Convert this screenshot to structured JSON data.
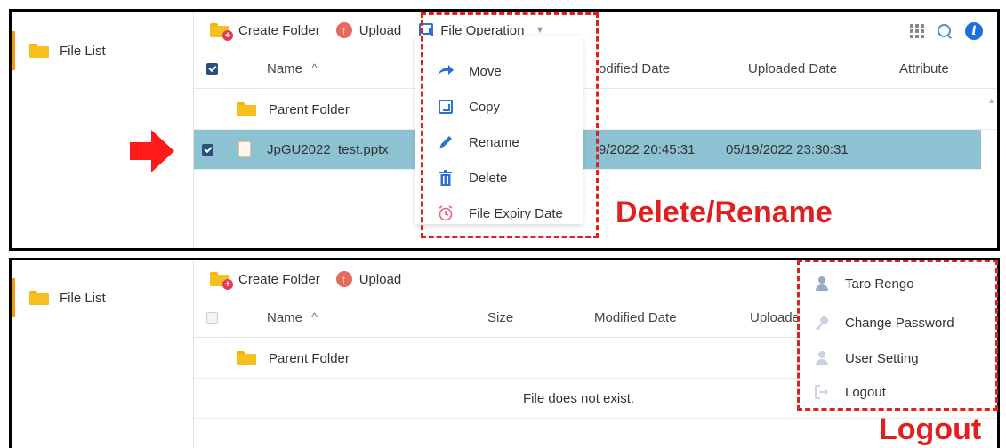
{
  "sidebar": {
    "file_list_label": "File List"
  },
  "toolbar": {
    "create_folder": "Create Folder",
    "upload": "Upload",
    "file_operation": "File Operation"
  },
  "columns": {
    "name": "Name",
    "sort_indicator": "^",
    "size": "Size",
    "modified_date": "Modified Date",
    "modified_date_partial": "odified Date",
    "uploaded_date": "Uploaded Date",
    "uploaded_date_partial": "Uploade",
    "attribute": "Attribute"
  },
  "rows_top": [
    {
      "name": "Parent Folder"
    },
    {
      "name": "JpGU2022_test.pptx",
      "modified_partial": "9/2022 20:45:31",
      "uploaded": "05/19/2022 23:30:31"
    }
  ],
  "file_operation_menu": [
    "Move",
    "Copy",
    "Rename",
    "Delete",
    "File Expiry Date"
  ],
  "rows_bottom": [
    {
      "name": "Parent Folder"
    },
    {
      "empty_message": "File does not exist."
    }
  ],
  "user_menu": {
    "user_name": "Taro Rengo",
    "items": [
      "Change Password",
      "User Setting",
      "Logout"
    ]
  },
  "callouts": {
    "delete_rename": "Delete/Rename",
    "logout": "Logout"
  },
  "colors": {
    "accent_orange": "#f39c12",
    "selected_row": "#8cc2d2",
    "callout_red": "#e02020",
    "checkbox_blue": "#2a4f7f"
  }
}
